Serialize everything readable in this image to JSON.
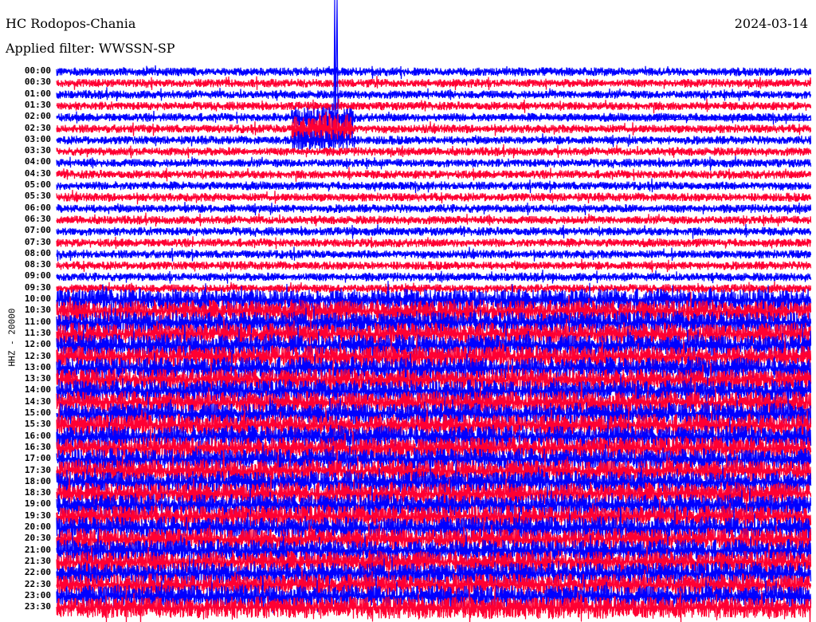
{
  "header": {
    "station": "HC Rodopos-Chania",
    "date": "2024-03-14",
    "filter": "Applied filter: WWSSN-SP"
  },
  "chart_data": {
    "type": "line",
    "title": "HC Rodopos-Chania",
    "ylabel": "HHZ - 20000",
    "xlabel": "",
    "colors": {
      "hour": "#0000ff",
      "half_hour": "#ff0033"
    },
    "rows": [
      "00:00",
      "00:30",
      "01:00",
      "01:30",
      "02:00",
      "02:30",
      "03:00",
      "03:30",
      "04:00",
      "04:30",
      "05:00",
      "05:30",
      "06:00",
      "06:30",
      "07:00",
      "07:30",
      "08:00",
      "08:30",
      "09:00",
      "09:30",
      "10:00",
      "10:30",
      "11:00",
      "11:30",
      "12:00",
      "12:30",
      "13:00",
      "13:30",
      "14:00",
      "14:30",
      "15:00",
      "15:30",
      "16:00",
      "16:30",
      "17:00",
      "17:30",
      "18:00",
      "18:30",
      "19:00",
      "19:30",
      "20:00",
      "20:30",
      "21:00",
      "21:30",
      "22:00",
      "22:30",
      "23:00",
      "23:30"
    ]
  }
}
